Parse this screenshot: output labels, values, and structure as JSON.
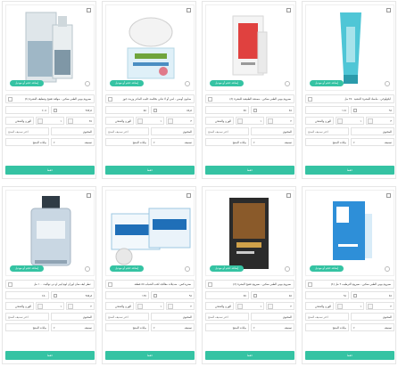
{
  "products": [
    {
      "id": "p1",
      "badge": "إضافة حجم أو موديل",
      "name": "(٤) سيروم بوبي الطبي سكين - مولفة تفتيح وتنظيف البشرة",
      "price": "٢٥٧٫٥",
      "old_price": "٤٠٥",
      "qty": "٢٥",
      "weight": "١",
      "shipping_label": "الوزن والشحن",
      "type_label": "المحتوى",
      "extra_label": "اختر تصنيف المنتج",
      "category_label": "تصنيف",
      "edit_label": "بيانات المنتج",
      "save_label": "حفظ",
      "art": "bottle-box"
    },
    {
      "id": "p2",
      "badge": "إضافة حجم أو موديل",
      "name": "صابون أوسن - لمن أو لا تباتي بخلاصة حليب الماعز وزيت جوز",
      "price": "٥٥٫٥",
      "old_price": "٨٥",
      "qty": "٣",
      "weight": "١",
      "shipping_label": "الوزن والشحن",
      "type_label": "المحتوى",
      "extra_label": "اختر تصنيف المنتج",
      "category_label": "تصنيف",
      "edit_label": "بيانات المنتج",
      "save_label": "حفظ",
      "art": "soap"
    },
    {
      "id": "p3",
      "badge": "إضافة حجم أو موديل",
      "name": "(٤) سيروم بوبي الطبي سكين - مصنعة الطبيعية للبشرة",
      "price": "٤٥",
      "old_price": "٧٥",
      "qty": "٢",
      "weight": "١",
      "shipping_label": "الوزن والشحن",
      "type_label": "المحتوى",
      "extra_label": "اختر تصنيف المنتج",
      "category_label": "تصنيف",
      "edit_label": "بيانات المنتج",
      "save_label": "حفظ",
      "art": "red-box"
    },
    {
      "id": "p4",
      "badge": "إضافة حجم أو موديل",
      "name": "ايكولوجي - ماسك للبشرة الدهنية ٢٥٠ مل",
      "price": "٦٥",
      "old_price": "١١٥",
      "qty": "٣",
      "weight": "١",
      "shipping_label": "الوزن والشحن",
      "type_label": "المحتوى",
      "extra_label": "اختر تصنيف المنتج",
      "category_label": "تصنيف",
      "edit_label": "بيانات المنتج",
      "save_label": "حفظ",
      "art": "tube"
    },
    {
      "id": "p5",
      "badge": "إضافة حجم أو موديل",
      "name": "عطر ايف سان لوران لوم ليبر او دي تواليت ١٠٠ مل",
      "price": "٢٨٨٫٨",
      "old_price": "٤٥٠",
      "qty": "٢",
      "weight": "١",
      "shipping_label": "الوزن والشحن",
      "type_label": "المحتوى",
      "extra_label": "اختر تصنيف المنتج",
      "category_label": "تصنيف",
      "edit_label": "بيانات المنتج",
      "save_label": "حفظ",
      "art": "perfume"
    },
    {
      "id": "p6",
      "badge": "إضافة حجم أو موديل",
      "name": "ستريدكس - منديلات معالجة لحب الشباب ٥٥ قطعة",
      "price": "٩٥",
      "old_price": "١٣٥",
      "qty": "٢",
      "weight": "١",
      "shipping_label": "الوزن والشحن",
      "type_label": "المحتوى",
      "extra_label": "اختر تصنيف المنتج",
      "category_label": "تصنيف",
      "edit_label": "بيانات المنتج",
      "save_label": "حفظ",
      "art": "stridex"
    },
    {
      "id": "p7",
      "badge": "إضافة حجم أو موديل",
      "name": "(٤) سيروم بوبي الطبي سكين - سيروم تفتيح البشرة",
      "price": "٥٥",
      "old_price": "٧٥",
      "qty": "٢",
      "weight": "١",
      "shipping_label": "الوزن والشحن",
      "type_label": "المحتوى",
      "extra_label": "اختر تصنيف المنتج",
      "category_label": "تصنيف",
      "edit_label": "بيانات المنتج",
      "save_label": "حفظ",
      "art": "dark-box"
    },
    {
      "id": "p8",
      "badge": "إضافة حجم أو موديل",
      "name": "(٤) سيروم بوبي الطبي سكين - سيروم الترطيب ٢ مل",
      "price": "٤٥",
      "old_price": "٦٥",
      "qty": "٢",
      "weight": "١",
      "shipping_label": "الوزن والشحن",
      "type_label": "المحتوى",
      "extra_label": "اختر تصنيف المنتج",
      "category_label": "تصنيف",
      "edit_label": "بيانات المنتج",
      "save_label": "حفظ",
      "art": "blue-box"
    }
  ],
  "colors": {
    "accent": "#35c3a3",
    "border": "#e2e2e2"
  }
}
